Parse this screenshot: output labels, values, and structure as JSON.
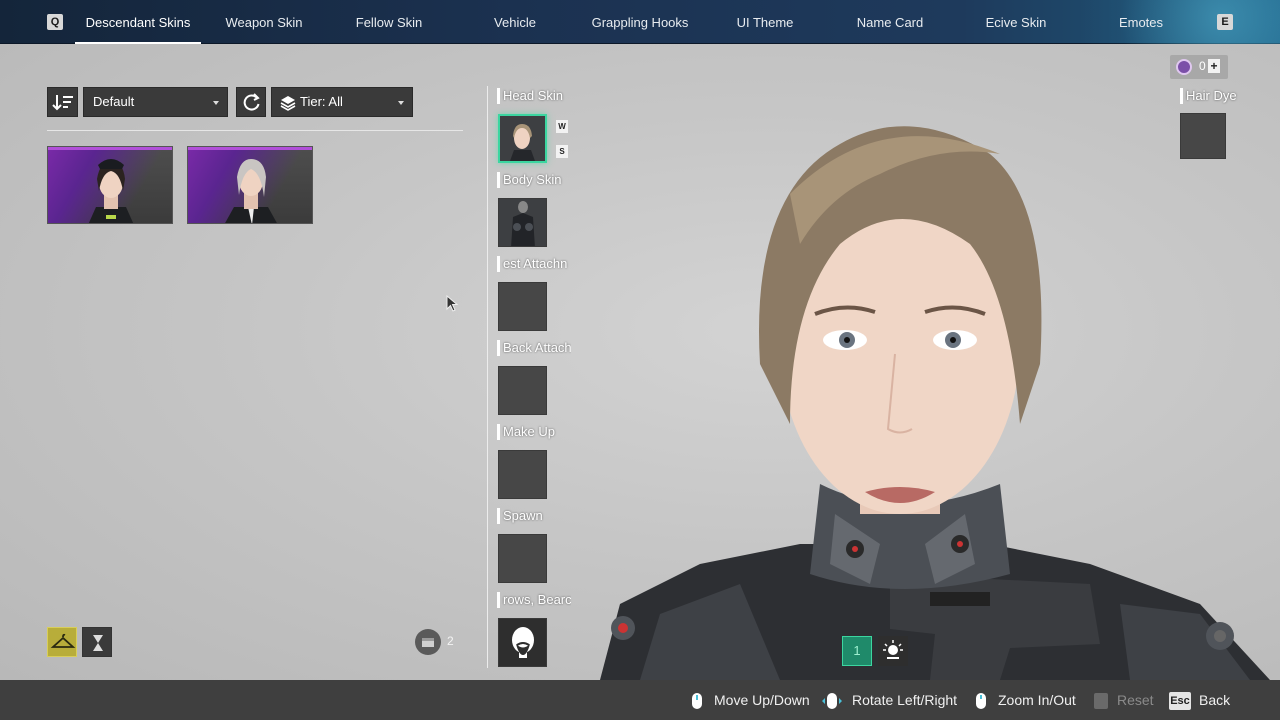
{
  "topnav": {
    "prev_key": "Q",
    "next_key": "E",
    "tabs": [
      {
        "label": "Descendant Skins",
        "active": true
      },
      {
        "label": "Weapon Skin",
        "active": false
      },
      {
        "label": "Fellow Skin",
        "active": false
      },
      {
        "label": "Vehicle",
        "active": false
      },
      {
        "label": "Grappling Hooks",
        "active": false
      },
      {
        "label": "UI Theme",
        "active": false
      },
      {
        "label": "Name Card",
        "active": false
      },
      {
        "label": "Ecive Skin",
        "active": false
      },
      {
        "label": "Emotes",
        "active": false
      }
    ]
  },
  "filters": {
    "sort_value": "Default",
    "tier_value": "Tier: All"
  },
  "skin_list": {
    "item_count": "2",
    "items": [
      {
        "name": "dark-haired-skin"
      },
      {
        "name": "silver-haired-skin"
      }
    ]
  },
  "slots": [
    {
      "label": "Head Skin",
      "state": "equipped"
    },
    {
      "label": "Body Skin",
      "state": "equipped"
    },
    {
      "label": "est Attachn",
      "state": "empty"
    },
    {
      "label": "Back Attach",
      "state": "empty"
    },
    {
      "label": "Make Up",
      "state": "empty"
    },
    {
      "label": "Spawn",
      "state": "empty"
    },
    {
      "label": "rows, Bearc",
      "state": "icon"
    }
  ],
  "head_tags": [
    "W",
    "S"
  ],
  "currency": {
    "amount": "0",
    "add_symbol": "+"
  },
  "hair_dye": {
    "label": "Hair Dye"
  },
  "view_controls": {
    "slot_number": "1"
  },
  "bottom_hints": [
    {
      "label": "Move Up/Down",
      "enabled": true
    },
    {
      "label": "Rotate Left/Right",
      "enabled": true
    },
    {
      "label": "Zoom In/Out",
      "enabled": true
    },
    {
      "label": "Reset",
      "enabled": false
    },
    {
      "key": "Esc",
      "label": "Back",
      "enabled": true
    }
  ],
  "colors": {
    "accent_selected": "#3bd6a0",
    "rarity_purple": "#b14fd9",
    "hanger_active": "#c8c04a"
  }
}
